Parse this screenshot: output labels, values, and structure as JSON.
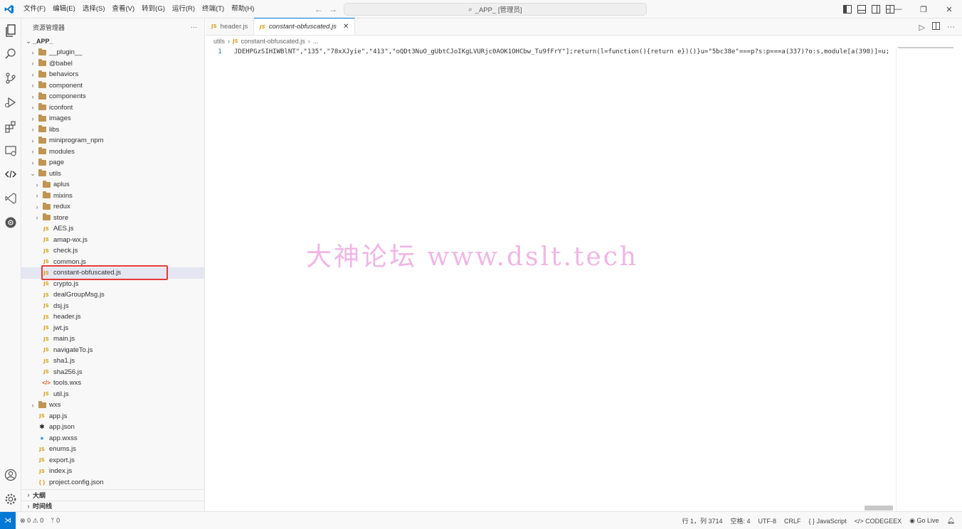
{
  "titlebar": {
    "menus": [
      "文件(F)",
      "编辑(E)",
      "选择(S)",
      "查看(V)",
      "转到(G)",
      "运行(R)",
      "终端(T)",
      "帮助(H)"
    ],
    "search_text": "_APP_ [管理员]"
  },
  "sidebar": {
    "title": "资源管理器",
    "more": "···",
    "root": "_APP_",
    "items": [
      {
        "label": "__plugin__",
        "type": "folder",
        "depth": 1,
        "expanded": false
      },
      {
        "label": "@babel",
        "type": "folder",
        "depth": 1,
        "expanded": false
      },
      {
        "label": "behaviors",
        "type": "folder",
        "depth": 1,
        "expanded": false
      },
      {
        "label": "component",
        "type": "folder",
        "depth": 1,
        "expanded": false
      },
      {
        "label": "components",
        "type": "folder",
        "depth": 1,
        "expanded": false
      },
      {
        "label": "iconfont",
        "type": "folder",
        "depth": 1,
        "expanded": false
      },
      {
        "label": "images",
        "type": "folder",
        "depth": 1,
        "expanded": false
      },
      {
        "label": "libs",
        "type": "folder",
        "depth": 1,
        "expanded": false
      },
      {
        "label": "miniprogram_npm",
        "type": "folder",
        "depth": 1,
        "expanded": false
      },
      {
        "label": "modules",
        "type": "folder",
        "depth": 1,
        "expanded": false
      },
      {
        "label": "page",
        "type": "folder",
        "depth": 1,
        "expanded": false
      },
      {
        "label": "utils",
        "type": "folder",
        "depth": 1,
        "expanded": true
      },
      {
        "label": "aplus",
        "type": "folder",
        "depth": 2,
        "expanded": false
      },
      {
        "label": "mixins",
        "type": "folder",
        "depth": 2,
        "expanded": false
      },
      {
        "label": "redux",
        "type": "folder",
        "depth": 2,
        "expanded": false
      },
      {
        "label": "store",
        "type": "folder",
        "depth": 2,
        "expanded": false
      },
      {
        "label": "AES.js",
        "type": "js",
        "depth": 2
      },
      {
        "label": "amap-wx.js",
        "type": "js",
        "depth": 2
      },
      {
        "label": "check.js",
        "type": "js",
        "depth": 2
      },
      {
        "label": "common.js",
        "type": "js",
        "depth": 2
      },
      {
        "label": "constant-obfuscated.js",
        "type": "js",
        "depth": 2,
        "selected": true
      },
      {
        "label": "crypto.js",
        "type": "js",
        "depth": 2
      },
      {
        "label": "dealGroupMsg.js",
        "type": "js",
        "depth": 2
      },
      {
        "label": "dsj.js",
        "type": "js",
        "depth": 2
      },
      {
        "label": "header.js",
        "type": "js",
        "depth": 2
      },
      {
        "label": "jwt.js",
        "type": "js",
        "depth": 2
      },
      {
        "label": "main.js",
        "type": "js",
        "depth": 2
      },
      {
        "label": "navigateTo.js",
        "type": "js",
        "depth": 2
      },
      {
        "label": "sha1.js",
        "type": "js",
        "depth": 2
      },
      {
        "label": "sha256.js",
        "type": "js",
        "depth": 2
      },
      {
        "label": "tools.wxs",
        "type": "wxs",
        "depth": 2
      },
      {
        "label": "util.js",
        "type": "js",
        "depth": 2
      },
      {
        "label": "wxs",
        "type": "folder",
        "depth": 1,
        "expanded": false
      },
      {
        "label": "app.js",
        "type": "js",
        "depth": 1
      },
      {
        "label": "app.json",
        "type": "json-app",
        "depth": 1
      },
      {
        "label": "app.wxss",
        "type": "wxss",
        "depth": 1
      },
      {
        "label": "enums.js",
        "type": "js",
        "depth": 1
      },
      {
        "label": "export.js",
        "type": "js",
        "depth": 1
      },
      {
        "label": "index.js",
        "type": "js",
        "depth": 1
      },
      {
        "label": "project.config.json",
        "type": "json",
        "depth": 1
      }
    ],
    "sections": [
      "大纲",
      "时间线"
    ]
  },
  "editor": {
    "tabs": [
      {
        "label": "header.js",
        "active": false
      },
      {
        "label": "constant-obfuscated.js",
        "active": true
      }
    ],
    "breadcrumb": [
      "utils",
      "constant-obfuscated.js",
      "..."
    ],
    "line_number": "1",
    "code": "JDEHPGzSIHIWBlNT\",\"135\",\"78xXJyie\",\"413\",\"oQDt3NuO_gUbtCJoIKgLVURjc0AOK1OHCbw_Tu9fFrY\"];return(l=function(){return e})()}u=\"5bc38e\"===p?s:p===a(337)?o:s,module[a(390)]=u;"
  },
  "watermark": "大神论坛  www.dslt.tech",
  "statusbar": {
    "errors": "0",
    "warnings": "0",
    "ports": "0",
    "position": "行 1，列 3714",
    "spaces": "空格: 4",
    "encoding": "UTF-8",
    "eol": "CRLF",
    "language": "JavaScript",
    "codegeex": "CODEGEEX",
    "golive": "Go Live"
  },
  "colors": {
    "accent": "#0078d4",
    "selection_box": "#e53935",
    "js_icon": "#d4a017",
    "folder": "#c09553",
    "watermark": "#f0b6e4"
  }
}
